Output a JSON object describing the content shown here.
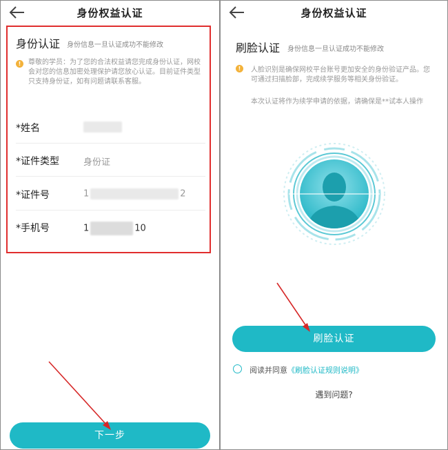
{
  "left": {
    "header": {
      "title": "身份权益认证"
    },
    "section": {
      "title": "身份认证",
      "subtitle": "身份信息一旦认证成功不能修改"
    },
    "notice": "尊敬的学员：为了您的合法权益请您完成身份认证，网校会对您的信息加密处理保护请您放心认证。目前证件类型只支持身份证，如有问题请联系客服。",
    "fields": [
      {
        "label": "*姓名",
        "value_prefix": "",
        "value_suffix": ""
      },
      {
        "label": "*证件类型",
        "value": "身份证"
      },
      {
        "label": "*证件号",
        "value_prefix": "1",
        "value_suffix": "2"
      },
      {
        "label": "*手机号",
        "value_prefix": "1",
        "value_suffix": "10"
      }
    ],
    "next_button": "下一步"
  },
  "right": {
    "header": {
      "title": "身份权益认证"
    },
    "section": {
      "title": "刷脸认证",
      "subtitle": "身份信息一旦认证成功不能修改"
    },
    "notice_1": "人脸识别是确保网校平台账号更加安全的身份验证产品。您可通过扫描脸部，完成续学服务等相关身份验证。",
    "notice_2": "本次认证将作为续学申请的依据，请确保是**试本人操作",
    "face_button": "刷脸认证",
    "agree_prefix": "阅读并同意",
    "agree_link": "《刷脸认证规则说明》",
    "problem_link": "遇到问题?"
  },
  "colors": {
    "accent": "#1fb9c6",
    "highlight_box": "#e02d2d",
    "warning_icon": "#f3b23a"
  }
}
